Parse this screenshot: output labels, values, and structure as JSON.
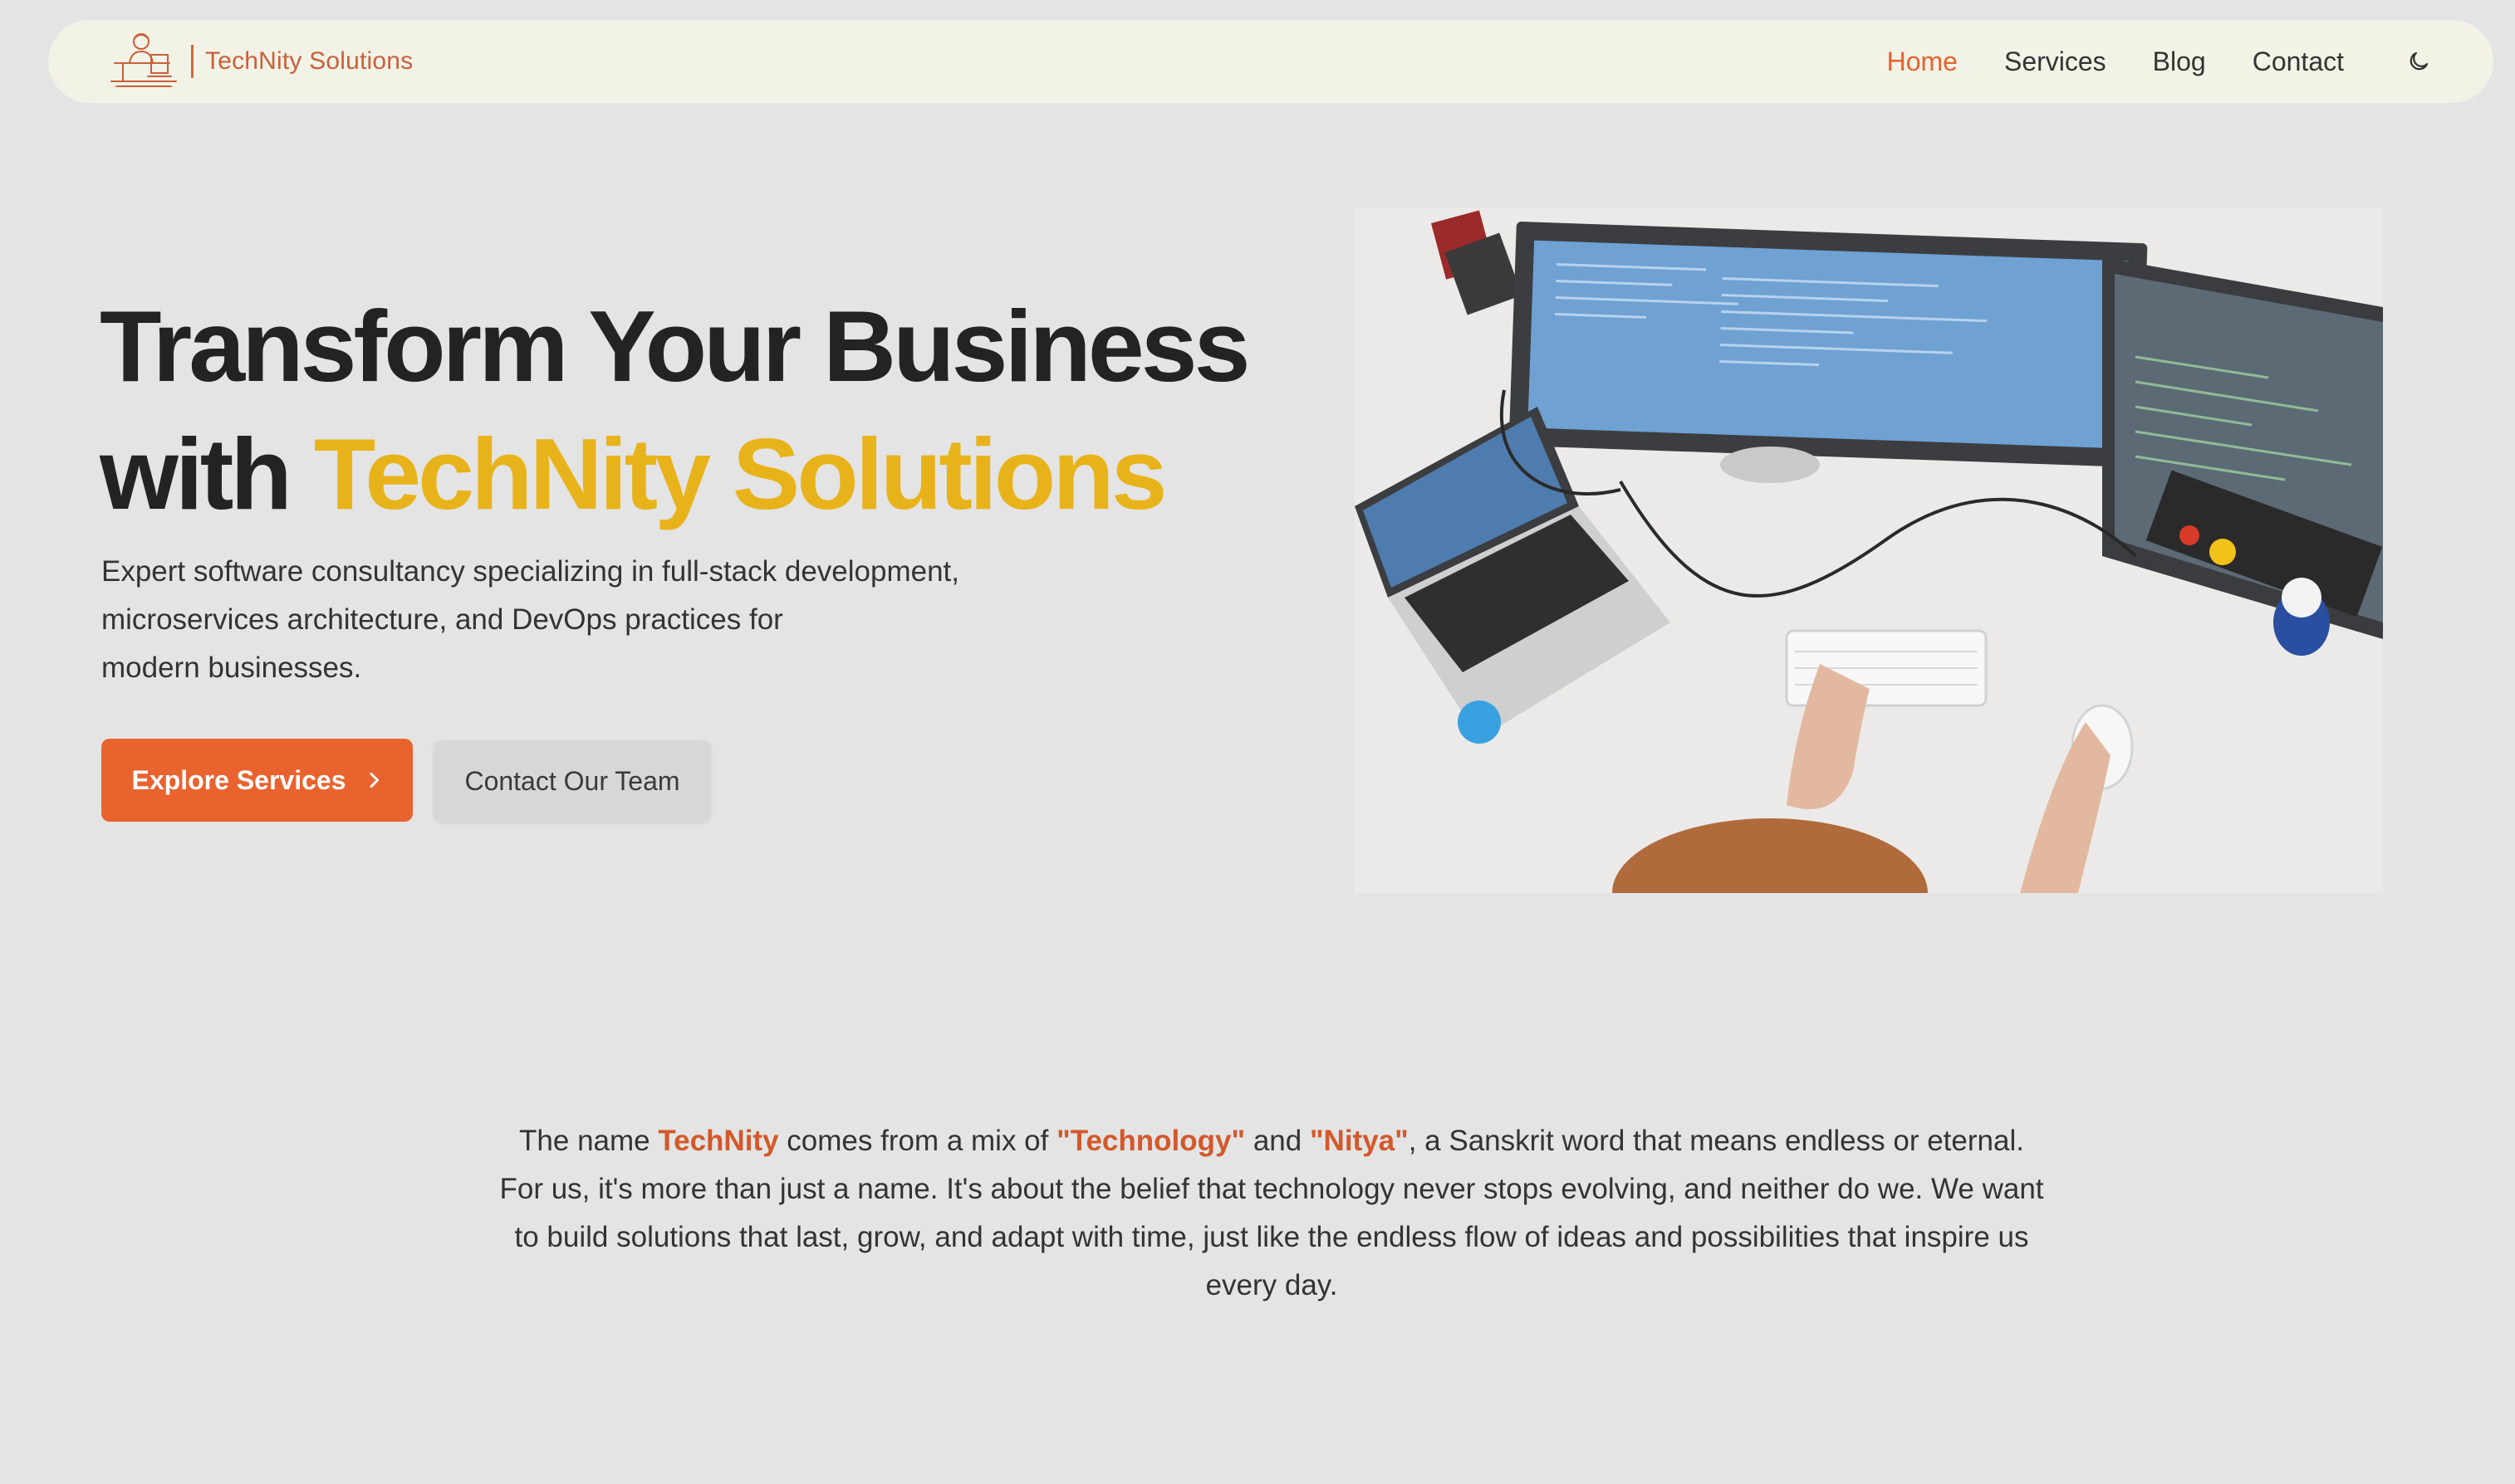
{
  "brand": {
    "name": "TechNity Solutions"
  },
  "nav": {
    "items": [
      {
        "label": "Home",
        "active": true
      },
      {
        "label": "Services",
        "active": false
      },
      {
        "label": "Blog",
        "active": false
      },
      {
        "label": "Contact",
        "active": false
      }
    ],
    "theme_toggle_icon": "moon-icon"
  },
  "hero": {
    "title_line1": "Transform Your Business",
    "title_line2_prefix": "with ",
    "title_line2_accent": "TechNity Solutions",
    "description_line1": "Expert software consultancy specializing in full-stack development,",
    "description_line2": "microservices architecture, and DevOps practices for",
    "description_line3": "modern businesses.",
    "primary_button": "Explore Services",
    "secondary_button": "Contact Our Team"
  },
  "about": {
    "part1": "The name ",
    "hl1": "TechNity",
    "part2": " comes from a mix of ",
    "hl2": "\"Technology\"",
    "part3": " and ",
    "hl3": "\"Nitya\"",
    "part4": ", a Sanskrit word that means endless or eternal. For us, it's more than just a name. It's about the belief that technology never stops evolving, and neither do we. We want to build solutions that last, grow, and adapt with time, just like the endless flow of ideas and possibilities that inspire us every day."
  },
  "colors": {
    "accent_orange": "#e9632f",
    "accent_yellow": "#e8b31a",
    "nav_bg": "#f2f2e6",
    "page_bg": "#e4e4e4"
  }
}
